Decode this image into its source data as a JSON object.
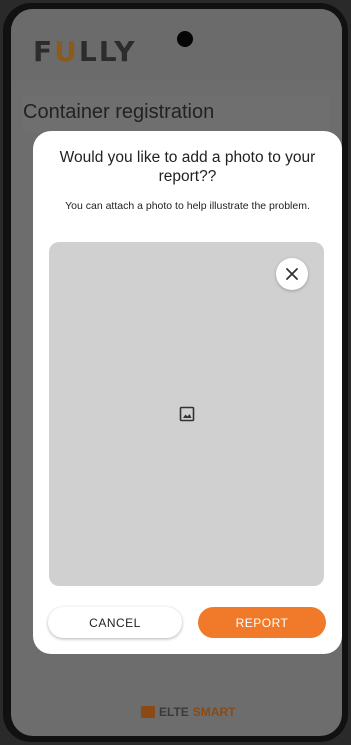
{
  "app": {
    "logo_text_1": "F",
    "logo_text_2": "U",
    "logo_text_3": "LLY",
    "page_title": "Container registration"
  },
  "dialog": {
    "title": "Would you like to add a photo to your report??",
    "subtitle": "You can attach a photo to help illustrate the problem.",
    "close_icon": "close-icon",
    "placeholder_icon": "image-icon",
    "cancel_label": "CANCEL",
    "report_label": "REPORT",
    "accent_color": "#f07a2a"
  },
  "footer": {
    "brand_part1": "ELTE",
    "brand_part2": "SMART"
  }
}
